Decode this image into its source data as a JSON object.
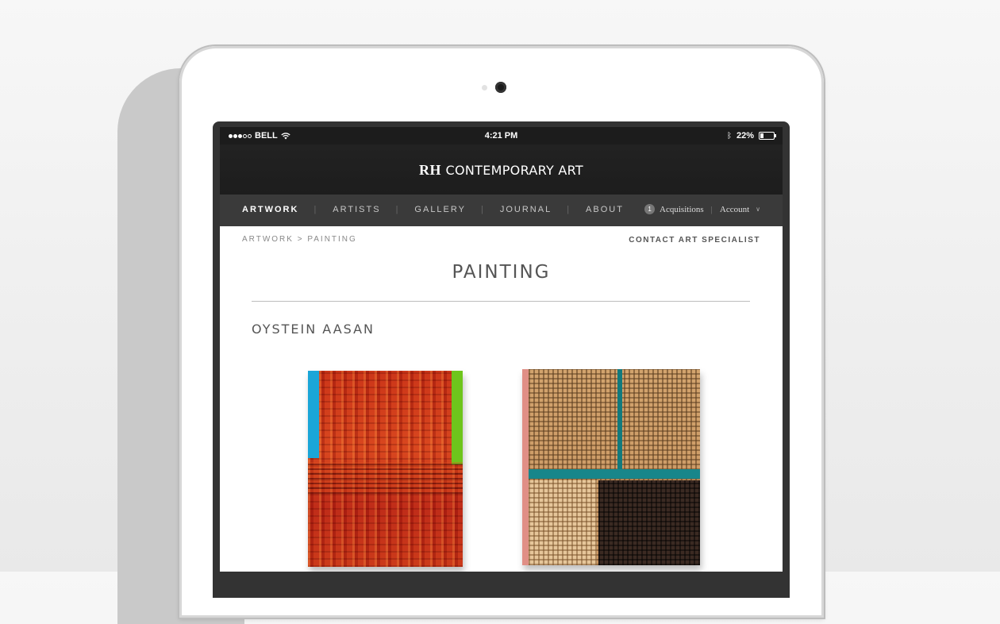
{
  "status_bar": {
    "carrier": "BELL",
    "time": "4:21 PM",
    "battery_percent_text": "22%",
    "battery_level": 0.22,
    "signal_bars_filled": 3,
    "signal_bars_total": 5
  },
  "header": {
    "logo_mark": "RH",
    "logo_text": "CONTEMPORARY ART"
  },
  "nav": {
    "items": [
      {
        "label": "ARTWORK",
        "active": true
      },
      {
        "label": "ARTISTS",
        "active": false
      },
      {
        "label": "GALLERY",
        "active": false
      },
      {
        "label": "JOURNAL",
        "active": false
      },
      {
        "label": "ABOUT",
        "active": false
      }
    ],
    "acquisitions_count": "1",
    "acquisitions_label": "Acquisitions",
    "account_label": "Account"
  },
  "breadcrumb": "ARTWORK > PAINTING",
  "contact_label": "CONTACT ART SPECIALIST",
  "page_title": "PAINTING",
  "artist_name": "OYSTEIN AASAN",
  "colors": {
    "header_bg": "#1d1d1d",
    "nav_bg": "#3a3a3a",
    "accent_blue": "#1aa6d8",
    "accent_green": "#6ec51c",
    "teal": "#18868a"
  }
}
